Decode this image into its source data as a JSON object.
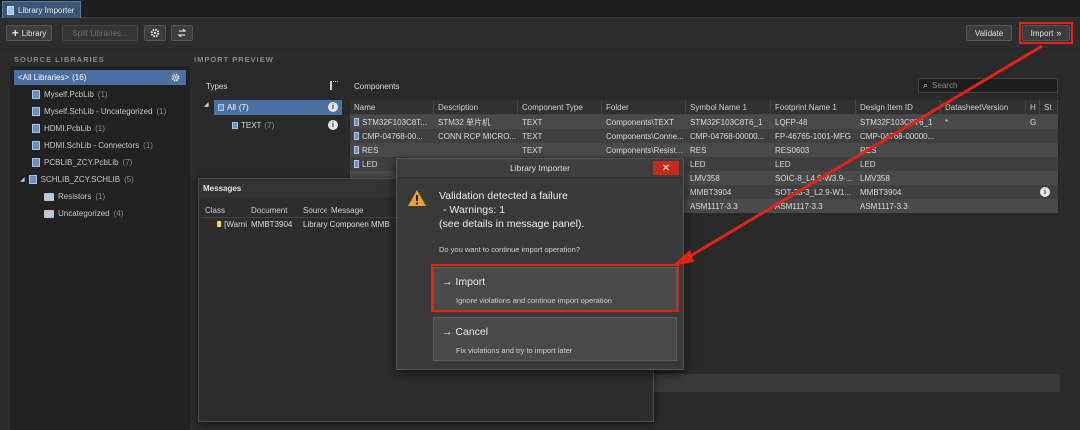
{
  "tab": {
    "title": "Library Importer"
  },
  "toolbar": {
    "add_library": "Library",
    "split_libraries": "Split Libraries...",
    "validate": "Validate",
    "import": "Import"
  },
  "source": {
    "title": "SOURCE LIBRARIES",
    "root": {
      "label": "<All Libraries>",
      "count": "(16)"
    },
    "items": [
      {
        "label": "Myself.PcbLib",
        "count": "(1)"
      },
      {
        "label": "Myself.SchLib - Uncategorized",
        "count": "(1)"
      },
      {
        "label": "HDMI.PcbLib",
        "count": "(1)"
      },
      {
        "label": "HDMI.SchLib - Connectors",
        "count": "(1)"
      },
      {
        "label": "PCBLIB_ZCY.PcbLib",
        "count": "(7)"
      },
      {
        "label": "SCHLIB_ZCY.SCHLIB",
        "count": "(5)"
      },
      {
        "label": "Resistors",
        "count": "(1)"
      },
      {
        "label": "Uncategorized",
        "count": "(4)"
      }
    ]
  },
  "preview": {
    "title": "IMPORT PREVIEW",
    "types_title": "Types",
    "types": [
      {
        "label": "All",
        "count": "(7)"
      },
      {
        "label": "TEXT",
        "count": "(7)"
      }
    ],
    "components_title": "Components",
    "search_placeholder": "Search",
    "columns": [
      "Name",
      "Description",
      "Component Type",
      "Folder",
      "Symbol Name 1",
      "Footprint Name 1",
      "Design Item ID",
      "DatasheetVersion",
      "H",
      "St"
    ],
    "rows": [
      [
        "STM32F103C8T...",
        "STM32 单片机",
        "TEXT",
        "Components\\TEXT",
        "STM32F103C8T6_1",
        "LQFP-48",
        "STM32F103C8T6_1",
        "*",
        "G"
      ],
      [
        "CMP-04768-00...",
        "CONN RCP MICRO...",
        "TEXT",
        "Components\\Conne...",
        "CMP-04768-00000...",
        "FP-46765-1001-MFG",
        "CMP-04768-00000...",
        "",
        ""
      ],
      [
        "RES",
        "",
        "TEXT",
        "Components\\Resist...",
        "RES",
        "RES0603",
        "RES",
        "",
        ""
      ],
      [
        "LED",
        "",
        "",
        "",
        "LED",
        "LED",
        "LED",
        "",
        ""
      ],
      [
        "",
        "",
        "",
        "",
        "LMV358",
        "SOIC-8_L4.9-W3.9-...",
        "LMV358",
        "",
        ""
      ],
      [
        "",
        "",
        "",
        "",
        "MMBT3904",
        "SOT-23-3_L2.9-W1...",
        "MMBT3904",
        "",
        ""
      ],
      [
        "",
        "",
        "",
        "",
        "ASM1117-3.3",
        "ASM1117-3.3",
        "ASM1117-3.3",
        "",
        ""
      ]
    ]
  },
  "messages": {
    "title": "Messages",
    "columns": [
      "Class",
      "Document",
      "Source",
      "Message"
    ],
    "rows": [
      {
        "class": "[Warni",
        "document": "MMBT3904",
        "source": "Library Component",
        "message": "MMB"
      }
    ]
  },
  "dialog": {
    "title": "Library Importer",
    "heading": "Validation detected a failure",
    "line2": "- Warnings: 1",
    "line3": "(see details in message panel).",
    "question": "Do you want to continue import operation?",
    "import_title": "Import",
    "import_desc": "Ignore violations and continue import operation",
    "cancel_title": "Cancel",
    "cancel_desc": "Fix violations and try to import later"
  },
  "colors": {
    "highlight": "#e0231b",
    "selection": "#4b6fa0",
    "warning": "#f0a030"
  }
}
